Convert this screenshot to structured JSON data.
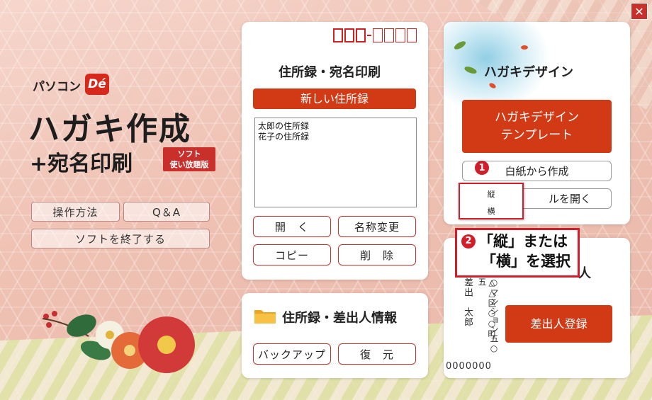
{
  "window": {
    "close_label": "✕"
  },
  "logo": {
    "brand": "パソコン",
    "brand_mark": "Dé",
    "title": "ハガキ作成",
    "subtitle": "+宛名印刷",
    "badge_line1": "ソフト",
    "badge_line2": "使い放題版"
  },
  "left_menu": {
    "howto": "操作方法",
    "qa": "Q＆A",
    "exit": "ソフトを終了する"
  },
  "address_panel": {
    "title": "住所録・宛名印刷",
    "new_button": "新しい住所録",
    "list_items": [
      "太郎の住所録",
      "花子の住所録"
    ],
    "open": "開　く",
    "rename": "名称変更",
    "copy": "コピー",
    "delete": "削　除"
  },
  "backup_panel": {
    "title": "住所録・差出人情報",
    "backup": "バックアップ",
    "restore": "復　元"
  },
  "design_panel": {
    "title": "ハガキデザイン",
    "template_button_line1": "ハガキデザイン",
    "template_button_line2": "テンプレート",
    "blank_button": "白紙から作成",
    "open_file_button": "ルを開く",
    "step1": "1"
  },
  "popup": {
    "vertical": "縦",
    "horizontal": "横"
  },
  "callout": {
    "step": "2",
    "line1": "「縦」または",
    "line2": "「横」を選択"
  },
  "sender_panel": {
    "title_partial": "人",
    "name": "差出　太郎",
    "address": "△△区○○町",
    "address2": "○マンション五○五",
    "register_button": "差出人登録",
    "zip": "0000000"
  },
  "colors": {
    "accent": "#d23a16",
    "highlight": "#d11e2a"
  }
}
